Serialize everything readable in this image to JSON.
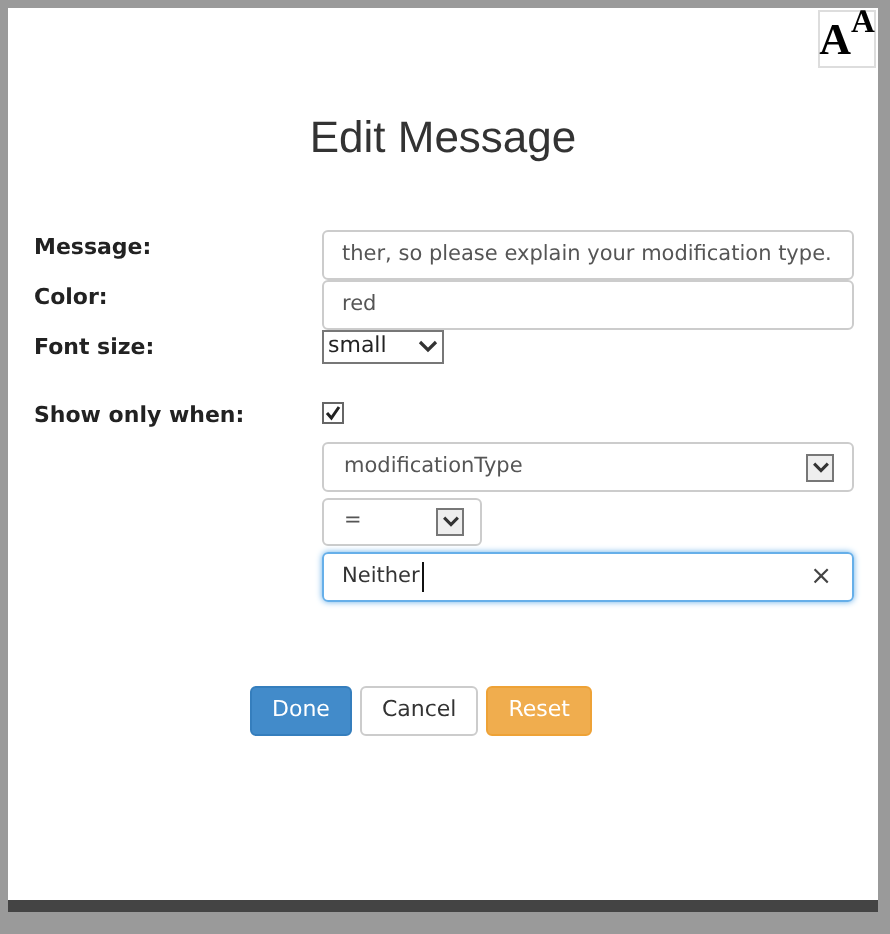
{
  "font_size_toggle": "A$^{A}$",
  "title": "Edit Message",
  "fields": [
    {
      "kind": "text",
      "label": "Message:",
      "value": "ther, so please explain your modification type."
    },
    {
      "kind": "text",
      "label": "Color:",
      "value": "red"
    },
    {
      "kind": "select",
      "label": "Font size:",
      "value": "small"
    },
    {
      "kind": "checkbox",
      "label": "Show only when:",
      "checked": true
    }
  ],
  "condition": {
    "field": "modificationType",
    "operator": "=",
    "value": "Neither",
    "clear": "×"
  },
  "buttons": [
    {
      "label": "Done",
      "kind": "primary"
    },
    {
      "label": "Cancel",
      "kind": "default"
    },
    {
      "label": "Reset",
      "kind": "warning"
    }
  ]
}
